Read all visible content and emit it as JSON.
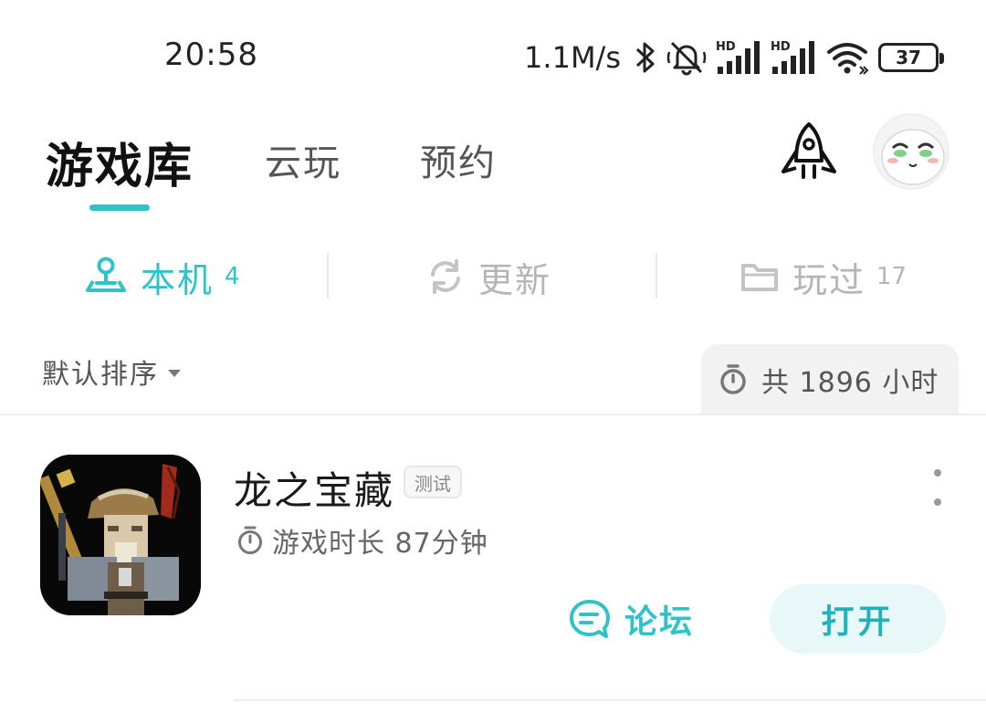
{
  "status_bar": {
    "time": "20:58",
    "net_speed": "1.1M/s",
    "battery": "37",
    "signal_label_1": "HD",
    "signal_label_2": "HD"
  },
  "top_tabs": {
    "main": "游戏库",
    "cloud": "云玩",
    "reserve": "预约"
  },
  "categories": {
    "local": {
      "label": "本机",
      "count": "4"
    },
    "update": {
      "label": "更新"
    },
    "played": {
      "label": "玩过",
      "count": "17"
    }
  },
  "sort": {
    "label": "默认排序",
    "total_label": "共 1896 小时"
  },
  "game": {
    "title": "龙之宝藏",
    "badge": "测试",
    "playtime": "游戏时长 87分钟",
    "forum_label": "论坛",
    "open_label": "打开"
  },
  "colors": {
    "accent": "#2ec3c8",
    "open_button_bg": "#e8f7f8",
    "inactive_text": "#b5b5b5",
    "chip_bg": "#f2f2f2"
  },
  "icons": {
    "rocket": "rocket-icon",
    "local": "joystick-icon",
    "update": "refresh-icon",
    "played": "folder-icon",
    "timer": "stopwatch-icon",
    "forum": "chat-bubble-icon",
    "more": "more-vertical-icon"
  }
}
